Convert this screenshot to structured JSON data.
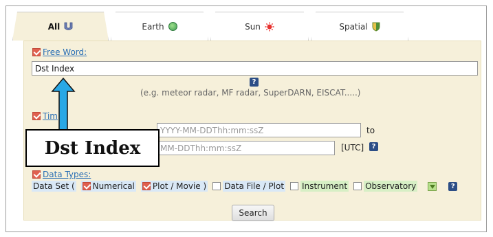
{
  "tabs": [
    {
      "label": "All",
      "icon": "all-filter-icon",
      "active": true
    },
    {
      "label": "Earth",
      "icon": "earth-icon",
      "active": false
    },
    {
      "label": "Sun",
      "icon": "sun-icon",
      "active": false
    },
    {
      "label": "Spatial",
      "icon": "spatial-shield-icon",
      "active": false
    }
  ],
  "free_word": {
    "label": "Free Word:",
    "value": "Dst Index",
    "hint": "(e.g. meteor radar, MF radar, SuperDARN, EISCAT.....)"
  },
  "time": {
    "label": "Tim",
    "start_placeholder": "YYYY-MM-DDThh:mm:ssZ",
    "end_placeholder": "MM-DDThh:mm:ssZ",
    "to_label": "to",
    "utc_label": "[UTC]"
  },
  "data_types": {
    "label": "Data Types:",
    "data_set_open": "Data Set (",
    "options": [
      {
        "label": "Numerical",
        "checked": true
      },
      {
        "label": "Plot / Movie )",
        "checked": true
      },
      {
        "label": "Data File / Plot",
        "checked": false
      },
      {
        "label": "Instrument",
        "checked": false
      },
      {
        "label": "Observatory",
        "checked": false
      }
    ]
  },
  "search_label": "Search",
  "callout_text": "Dst Index",
  "colors": {
    "panel": "#f6f0da",
    "accent_check": "#e0604f",
    "arrow": "#29a8e6",
    "link": "#2a6fb5"
  }
}
